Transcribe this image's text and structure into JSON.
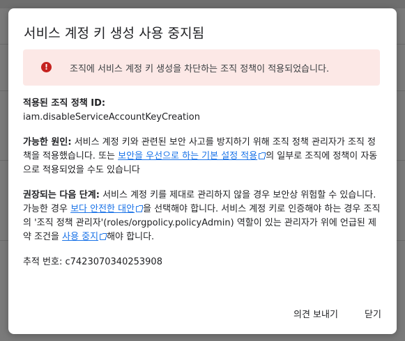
{
  "dialog": {
    "title": "서비스 계정 키 생성 사용 중지됨",
    "alert": {
      "icon": "error-icon",
      "text": "조직에 서비스 계정 키 생성을 차단하는 조직 정책이 적용되었습니다."
    },
    "policy": {
      "label": "적용된 조직 정책 ID:",
      "value": "iam.disableServiceAccountKeyCreation"
    },
    "cause": {
      "label": "가능한 원인:",
      "text_1": " 서비스 계정 키와 관련된 보안 사고를 방지하기 위해 조직 정책 관리자가 조직 정책을 적용했습니다. 또는 ",
      "link": "보안을 우선으로 하는 기본 설정 적용",
      "text_2": "의 일부로 조직에 정책이 자동으로 적용되었을 수도 있습니다"
    },
    "next_steps": {
      "label": "권장되는 다음 단계:",
      "text_1": " 서비스 계정 키를 제대로 관리하지 않을 경우 보안상 위험할 수 있습니다. 가능한 경우 ",
      "link_1": "보다 안전한 대안",
      "text_2": "을 선택해야 합니다. 서비스 계정 키로 인증해야 하는 경우 조직의 '조직 정책 관리자'(roles/orgpolicy.policyAdmin) 역할이 있는 관리자가 위에 언급된 제약 조건을 ",
      "link_2": "사용 중지",
      "text_3": "해야 합니다."
    },
    "tracking": {
      "text": "추적 번호: c7423070340253908"
    },
    "buttons": {
      "feedback": "의견 보내기",
      "close": "닫기"
    }
  }
}
